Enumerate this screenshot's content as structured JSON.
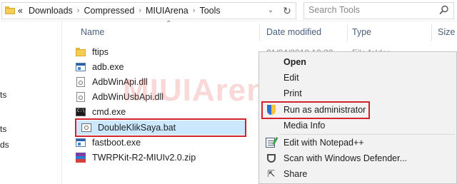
{
  "address": {
    "prefix": "«",
    "path": [
      "Downloads",
      "Compressed",
      "MIUIArena",
      "Tools"
    ],
    "separator": "›",
    "dropdown_icon": "chevron-down-icon",
    "refresh_icon": "refresh-icon"
  },
  "search": {
    "placeholder": "Search Tools"
  },
  "nav_fragments": [
    "ts",
    "ts",
    "ds"
  ],
  "columns": {
    "name": "Name",
    "date_modified": "Date modified",
    "type": "Type",
    "size": "Size"
  },
  "files": [
    {
      "name": "ftips",
      "icon": "folder-icon"
    },
    {
      "name": "adb.exe",
      "icon": "exe-icon"
    },
    {
      "name": "AdbWinApi.dll",
      "icon": "dll-icon"
    },
    {
      "name": "AdbWinUsbApi.dll",
      "icon": "dll-icon"
    },
    {
      "name": "cmd.exe",
      "icon": "cmd-icon"
    },
    {
      "name": "DoubleKlikSaya.bat",
      "icon": "bat-icon",
      "selected": true
    },
    {
      "name": "fastboot.exe",
      "icon": "exe-icon"
    },
    {
      "name": "TWRPKit-R2-MIUIv2.0.zip",
      "icon": "zip-icon"
    }
  ],
  "first_row_date_fragment": "01/04/2018 10:30",
  "first_row_type_fragment": "File folder",
  "watermark": "MIUIArena",
  "context_menu": {
    "items": [
      {
        "label": "Open",
        "bold": true
      },
      {
        "label": "Edit"
      },
      {
        "label": "Print"
      },
      {
        "label": "Run as administrator",
        "icon": "uac-shield-icon",
        "highlighted": true
      },
      {
        "label": "Media Info"
      },
      {
        "label": "Edit with Notepad++",
        "icon": "notepad-plus-plus-icon"
      },
      {
        "label": "Scan with Windows Defender...",
        "icon": "windows-defender-icon"
      },
      {
        "label": "Share",
        "icon": "share-icon"
      }
    ]
  },
  "colors": {
    "highlight": "#d3242d",
    "selection": "#cce8ff",
    "menu_bg": "#f2f2f2"
  }
}
